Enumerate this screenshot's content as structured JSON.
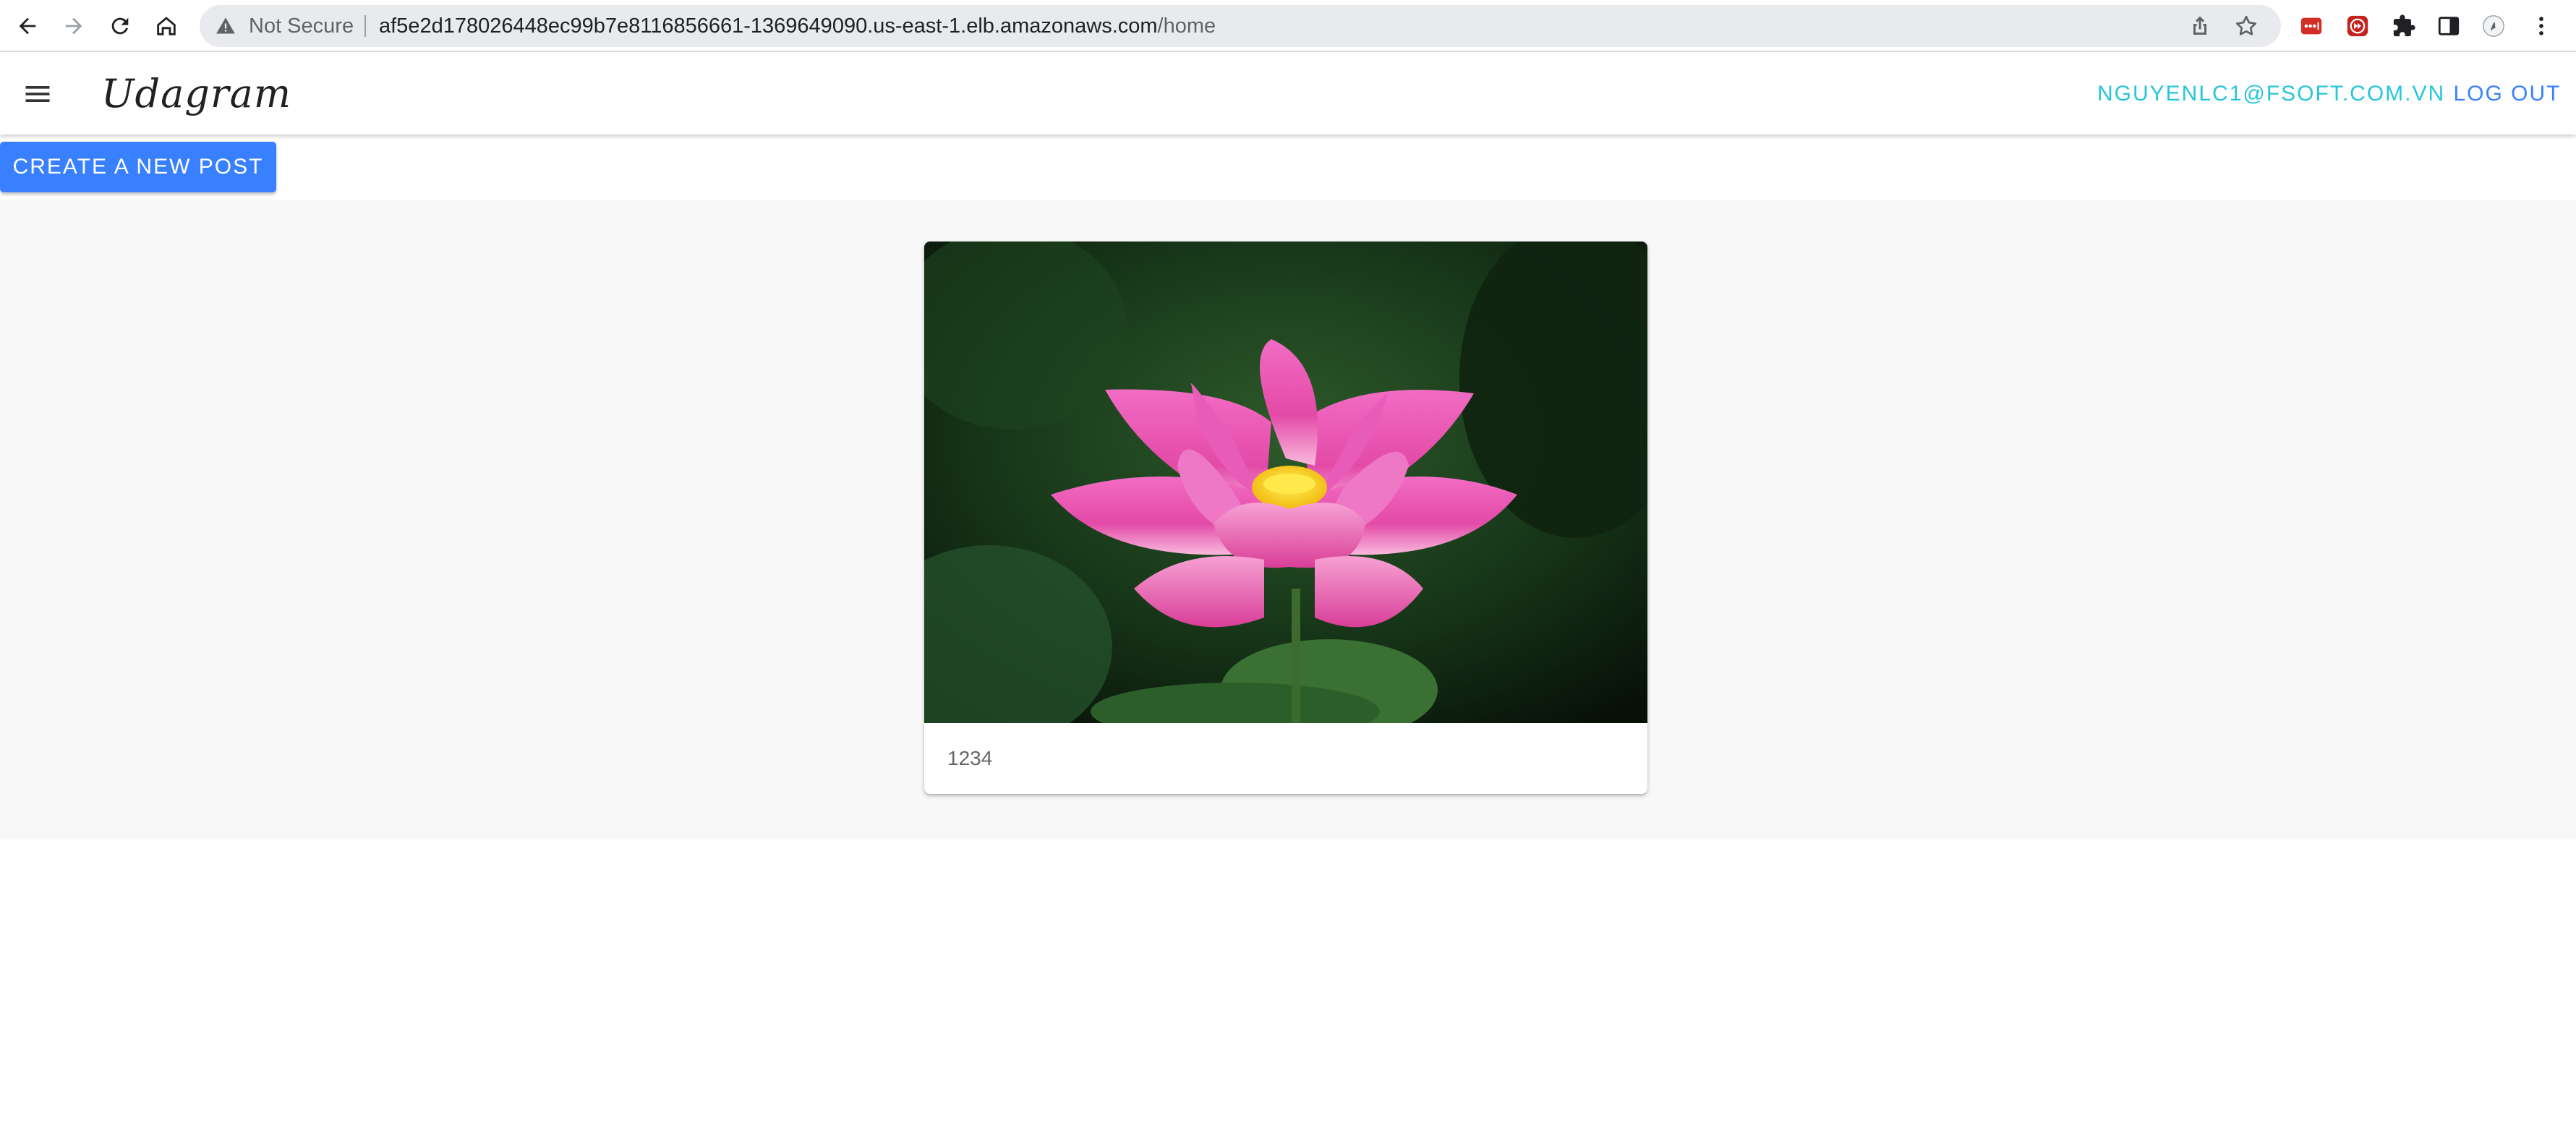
{
  "browser": {
    "security_label": "Not Secure",
    "url_host": "af5e2d178026448ec99b7e8116856661-1369649090.us-east-1.elb.amazonaws.com",
    "url_path": "/home"
  },
  "app": {
    "brand": "Udagram",
    "user_email": "NGUYENLC1@FSOFT.COM.VN",
    "logout_label": "LOG OUT",
    "create_post_label": "CREATE A NEW POST",
    "accent_color": "#3880ff",
    "email_color": "#26c6da"
  },
  "feed": {
    "posts": [
      {
        "caption": "1234",
        "image_subject": "pink lotus flower"
      }
    ]
  }
}
